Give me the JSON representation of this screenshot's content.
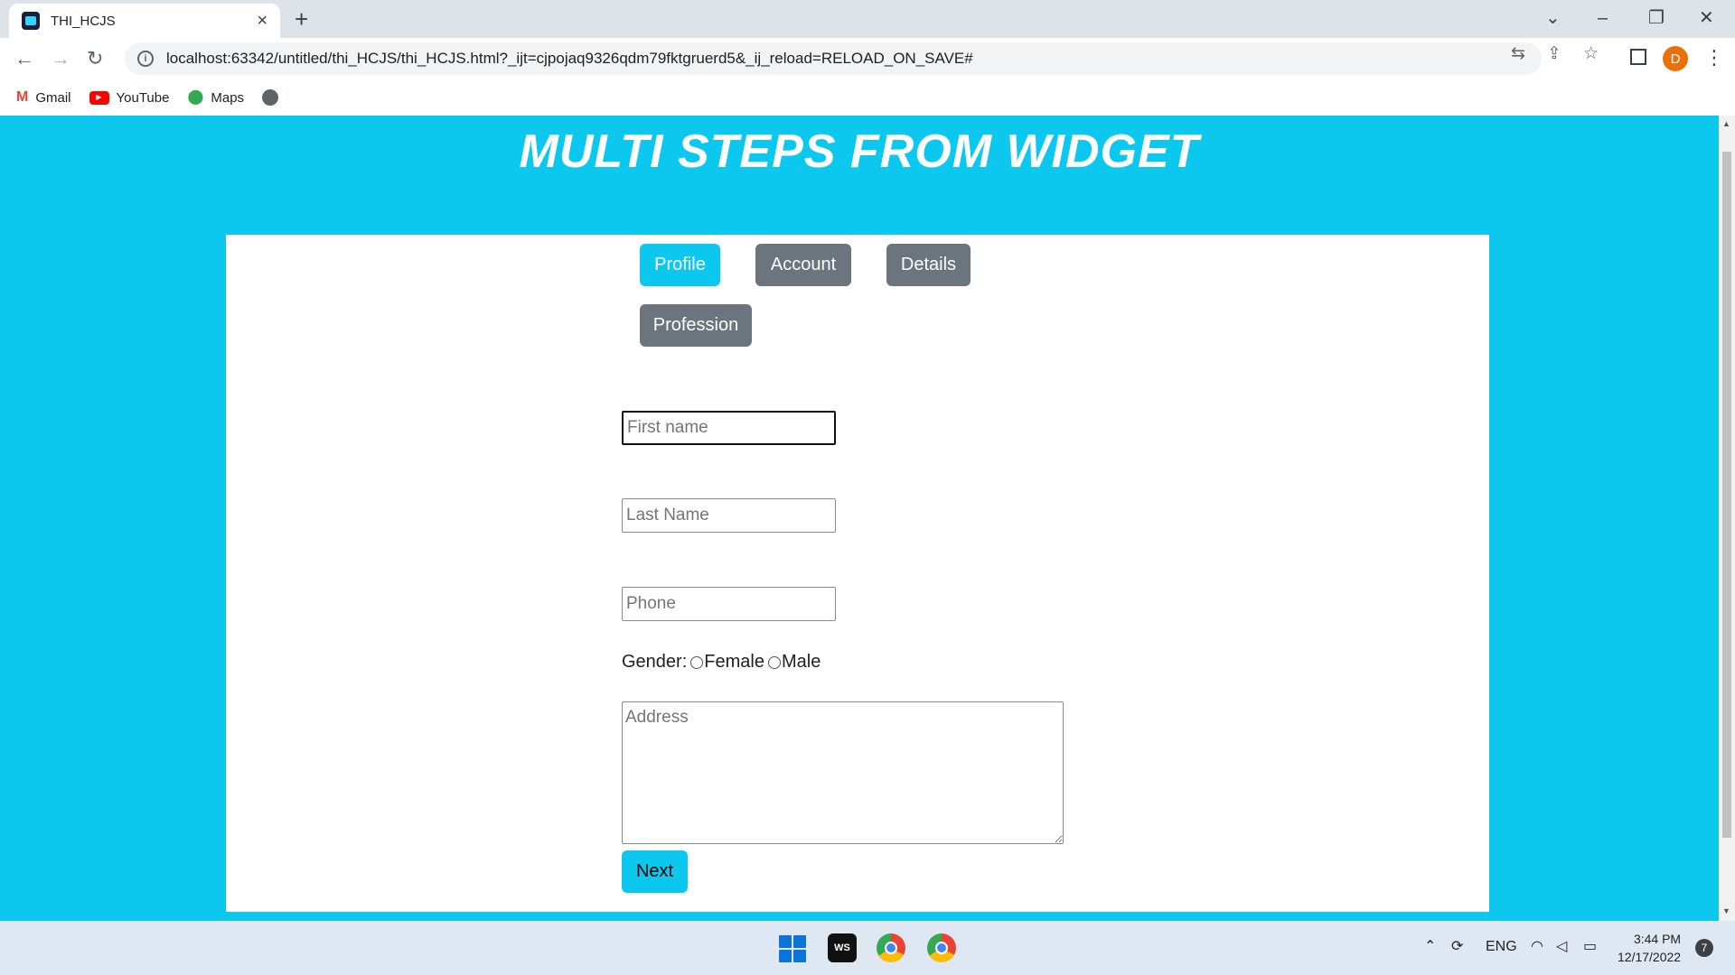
{
  "browser": {
    "tab_title": "THI_HCJS",
    "url": "localhost:63342/untitled/thi_HCJS/thi_HCJS.html?_ijt=cjpojaq9326qdm79fktgruerd5&_ij_reload=RELOAD_ON_SAVE#",
    "profile_initial": "D",
    "bookmarks": [
      {
        "label": "Gmail",
        "icon": "gmail-icon"
      },
      {
        "label": "YouTube",
        "icon": "youtube-icon"
      },
      {
        "label": "Maps",
        "icon": "maps-icon"
      }
    ]
  },
  "page": {
    "title": "MULTI STEPS FROM WIDGET",
    "steps": [
      "Profile",
      "Account",
      "Details",
      "Profession"
    ],
    "active_step": "Profile",
    "form": {
      "first_name_placeholder": "First name",
      "last_name_placeholder": "Last Name",
      "phone_placeholder": "Phone",
      "gender_label": "Gender:",
      "gender_options": [
        "Female",
        "Male"
      ],
      "address_placeholder": "Address",
      "next_label": "Next"
    }
  },
  "taskbar": {
    "language": "ENG",
    "time": "3:44 PM",
    "date": "12/17/2022",
    "notifications": "7",
    "ws_label": "WS"
  },
  "colors": {
    "accent": "#0dc8ee",
    "inactive_step": "#6c757d"
  }
}
